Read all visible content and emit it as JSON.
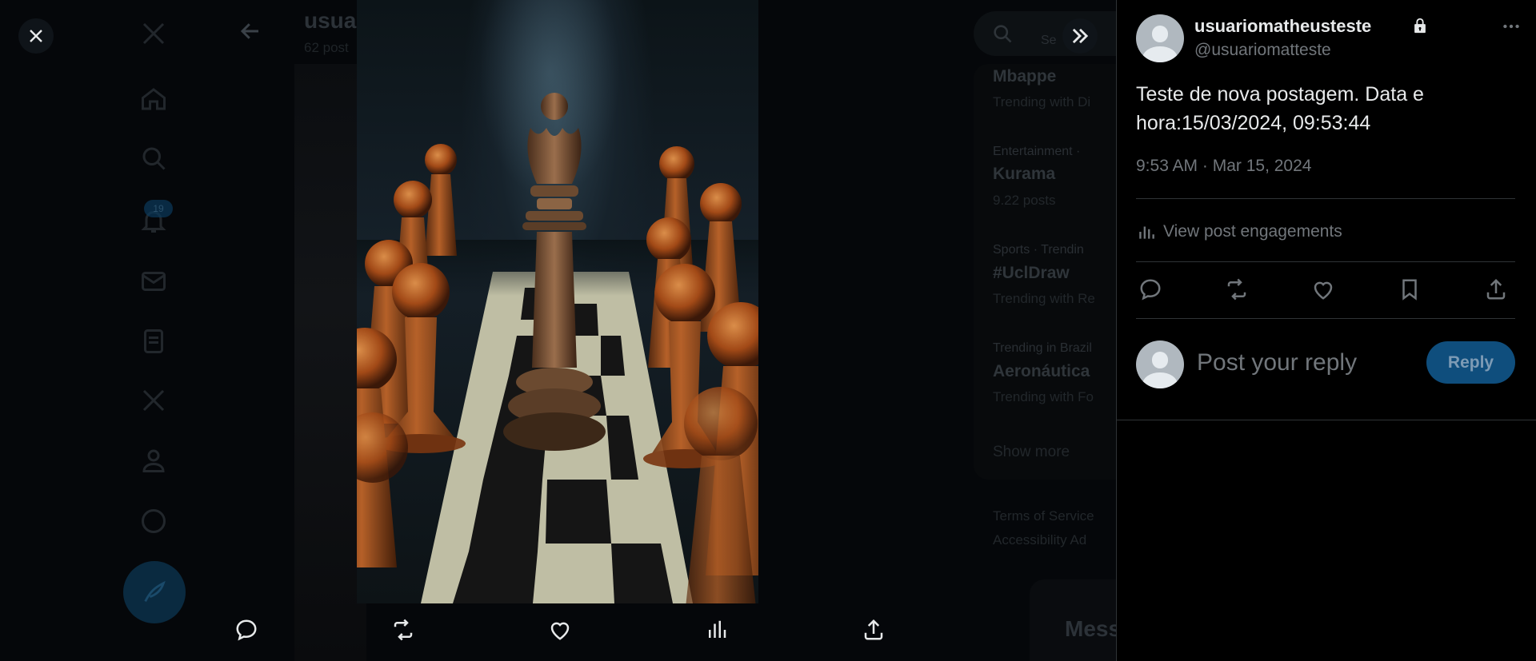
{
  "background": {
    "profile_title": "usua",
    "profile_subtitle": "62 post",
    "notification_count": "19",
    "search_placeholder": "Se",
    "trends": [
      {
        "category": "",
        "name": "Mbappe",
        "meta": "Trending with Di"
      },
      {
        "category": "Entertainment ·",
        "name": "Kurama",
        "meta": "9.22 posts"
      },
      {
        "category": "Sports · Trendin",
        "name": "#UclDraw",
        "meta": "Trending with Re"
      },
      {
        "category": "Trending in Brazil",
        "name": "Aeronáutica",
        "meta": "Trending with Fo"
      }
    ],
    "show_more": "Show more",
    "footer_line1": "Terms of Service",
    "footer_line2": "Accessibility   Ad",
    "messages_label": "Messa"
  },
  "media": {
    "alt": "Wooden chess king between rows of pawns on a chessboard",
    "actions": [
      {
        "name": "reply-icon",
        "label": "Reply"
      },
      {
        "name": "repost-icon",
        "label": "Repost"
      },
      {
        "name": "like-icon",
        "label": "Like"
      },
      {
        "name": "views-icon",
        "label": "View"
      },
      {
        "name": "share-icon",
        "label": "Share"
      }
    ]
  },
  "post": {
    "display_name": "usuariomatheusteste",
    "handle": "@usuariomatteste",
    "protected": true,
    "text": "Teste de nova postagem. Data e hora:15/03/2024, 09:53:44",
    "timestamp": "9:53 AM · Mar 15, 2024",
    "engagements_label": "View post engagements"
  },
  "reply": {
    "placeholder": "Post your reply",
    "button_label": "Reply"
  },
  "colors": {
    "accent": "#1d9bf0",
    "reply_button_bg": "#0f4e7d",
    "text_primary": "#e7e9ea",
    "text_secondary": "#71767b",
    "border": "#2f3336"
  }
}
